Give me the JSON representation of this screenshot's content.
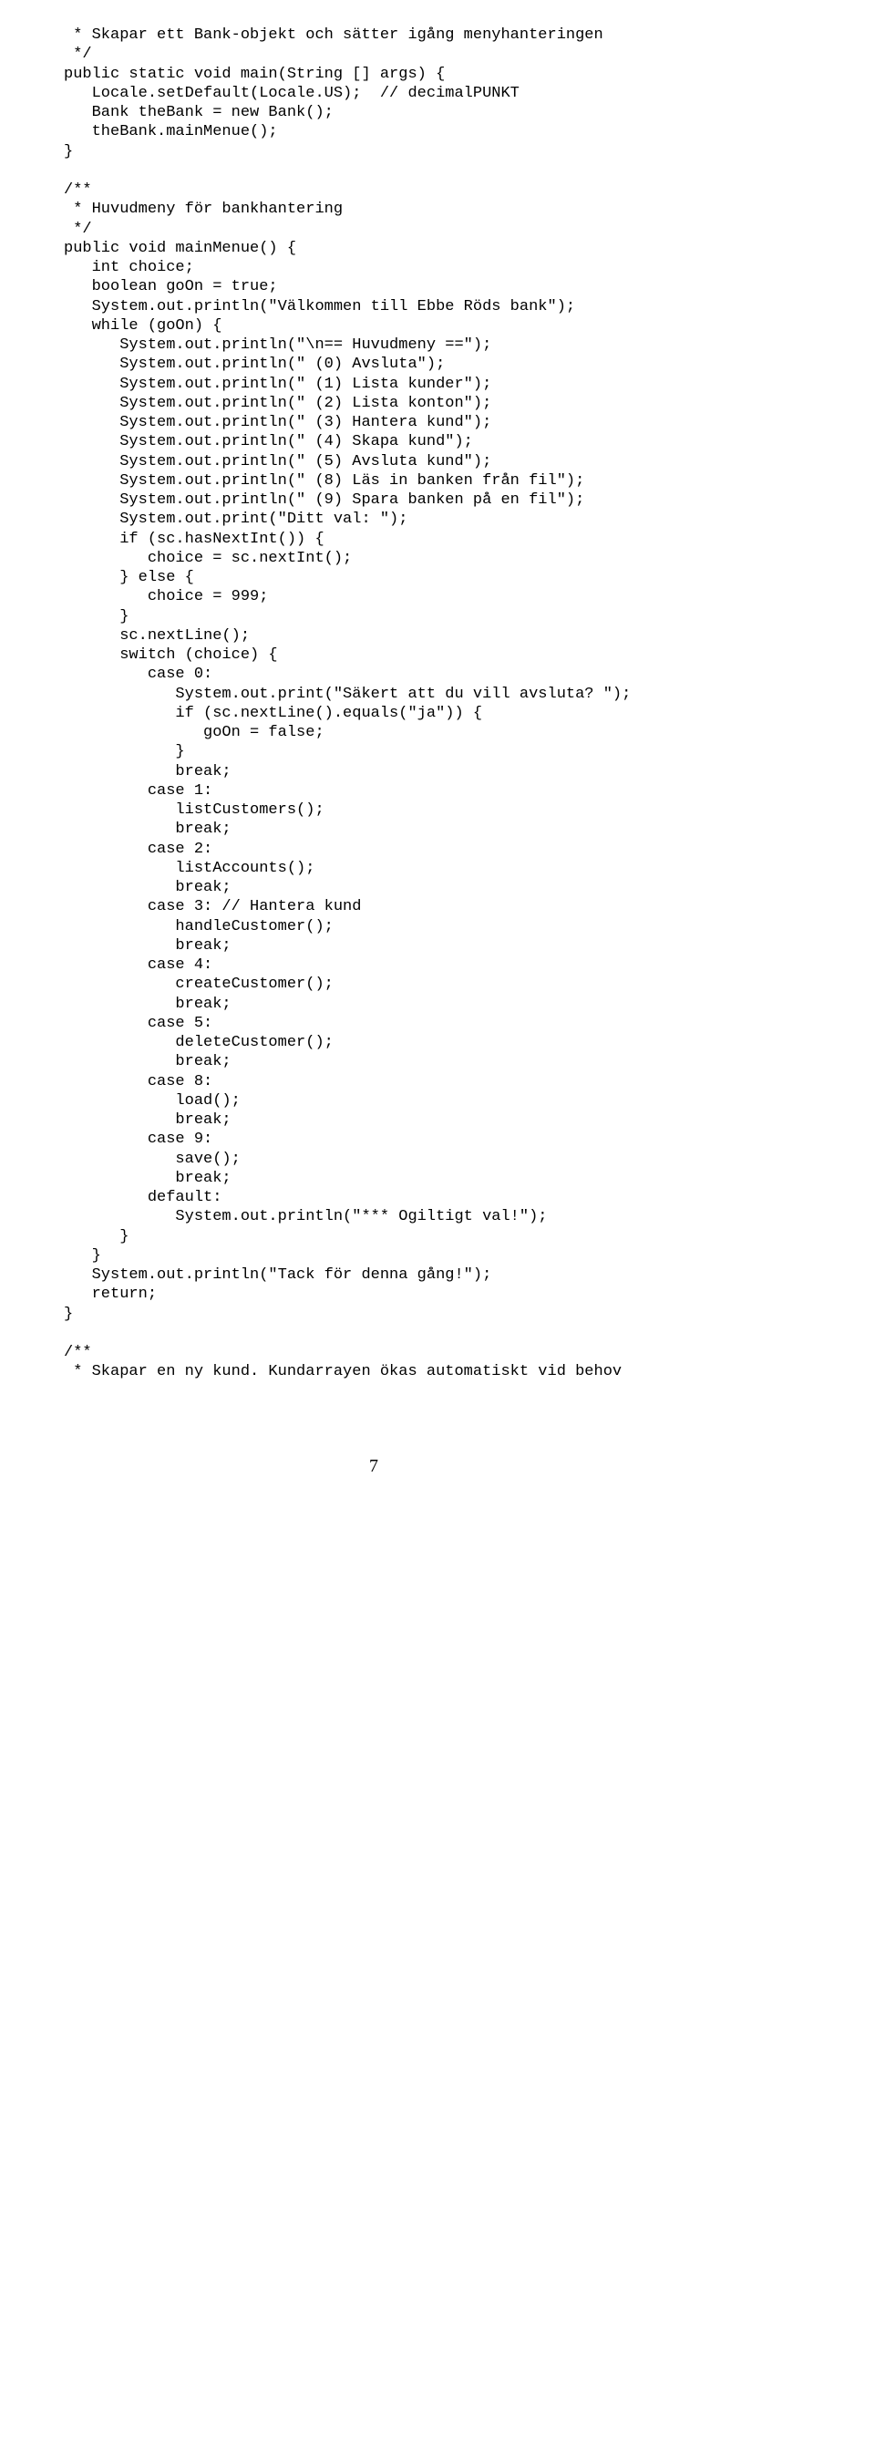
{
  "code": {
    "lines": [
      " * Skapar ett Bank-objekt och sätter igång menyhanteringen",
      " */",
      "public static void main(String [] args) {",
      "   Locale.setDefault(Locale.US);  // decimalPUNKT",
      "   Bank theBank = new Bank();",
      "   theBank.mainMenue();",
      "}",
      "",
      "/**",
      " * Huvudmeny för bankhantering",
      " */",
      "public void mainMenue() {",
      "   int choice;",
      "   boolean goOn = true;",
      "   System.out.println(\"Välkommen till Ebbe Röds bank\");",
      "   while (goOn) {",
      "      System.out.println(\"\\n== Huvudmeny ==\");",
      "      System.out.println(\" (0) Avsluta\");",
      "      System.out.println(\" (1) Lista kunder\");",
      "      System.out.println(\" (2) Lista konton\");",
      "      System.out.println(\" (3) Hantera kund\");",
      "      System.out.println(\" (4) Skapa kund\");",
      "      System.out.println(\" (5) Avsluta kund\");",
      "      System.out.println(\" (8) Läs in banken från fil\");",
      "      System.out.println(\" (9) Spara banken på en fil\");",
      "      System.out.print(\"Ditt val: \");",
      "      if (sc.hasNextInt()) {",
      "         choice = sc.nextInt();",
      "      } else {",
      "         choice = 999;",
      "      }",
      "      sc.nextLine();",
      "      switch (choice) {",
      "         case 0:",
      "            System.out.print(\"Säkert att du vill avsluta? \");",
      "            if (sc.nextLine().equals(\"ja\")) {",
      "               goOn = false;",
      "            }",
      "            break;",
      "         case 1:",
      "            listCustomers();",
      "            break;",
      "         case 2:",
      "            listAccounts();",
      "            break;",
      "         case 3: // Hantera kund",
      "            handleCustomer();",
      "            break;",
      "         case 4:",
      "            createCustomer();",
      "            break;",
      "         case 5:",
      "            deleteCustomer();",
      "            break;",
      "         case 8:",
      "            load();",
      "            break;",
      "         case 9:",
      "            save();",
      "            break;",
      "         default:",
      "            System.out.println(\"*** Ogiltigt val!\");",
      "      }",
      "   }",
      "   System.out.println(\"Tack för denna gång!\");",
      "   return;",
      "}",
      "",
      "/**",
      " * Skapar en ny kund. Kundarrayen ökas automatiskt vid behov"
    ]
  },
  "page_number": "7"
}
